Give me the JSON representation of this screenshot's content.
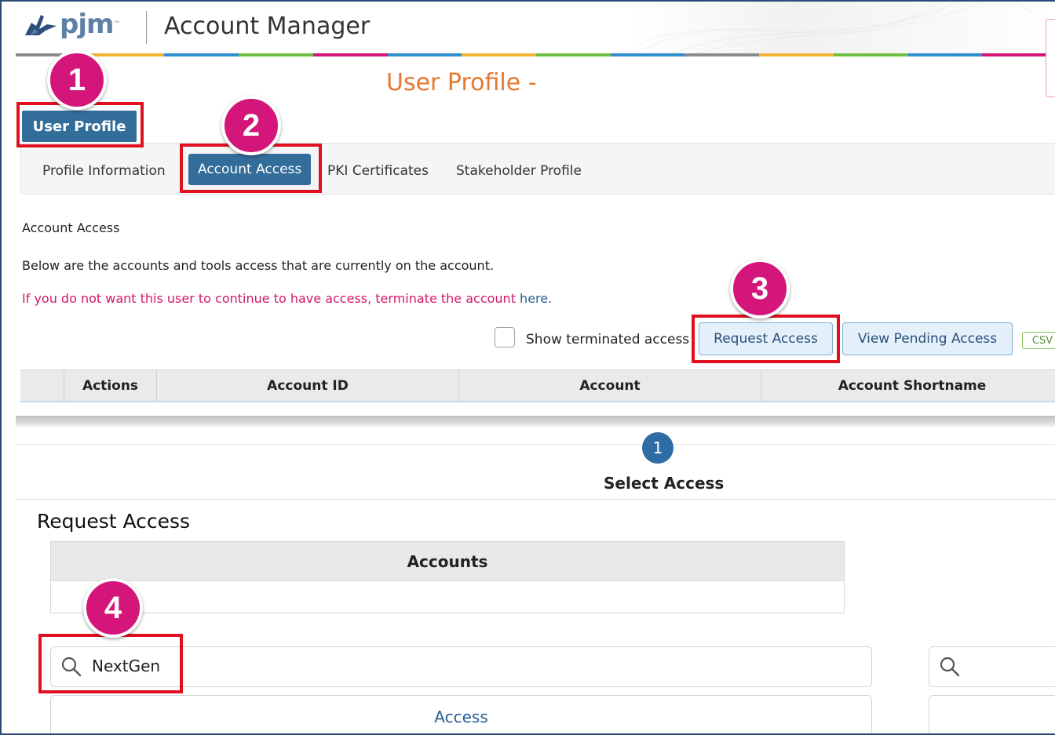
{
  "header": {
    "logo_text": "pjm",
    "logo_tm": "™",
    "app_title": "Account Manager",
    "stripe_colors": [
      "#8a8d8f",
      "#f5b335",
      "#2f8fcf",
      "#6fbf44",
      "#d4157a",
      "#2f8fcf",
      "#f5b335",
      "#6fbf44",
      "#2f8fcf",
      "#8a8d8f",
      "#f5b335",
      "#6fbf44",
      "#2f8fcf",
      "#d4157a"
    ]
  },
  "page": {
    "title": "User Profile -",
    "user_profile_button": "User Profile"
  },
  "tabs": [
    {
      "label": "Profile Information",
      "active": false
    },
    {
      "label": "Account Access",
      "active": true
    },
    {
      "label": "PKI Certificates",
      "active": false
    },
    {
      "label": "Stakeholder Profile",
      "active": false
    }
  ],
  "account_access": {
    "section_label": "Account Access",
    "description": "Below are the accounts and tools access that are currently on the account.",
    "warning_text": "If you do not want this user to continue to have access, terminate the account ",
    "warning_link": "here.",
    "show_terminated_label": "Show terminated access",
    "request_access_button": "Request Access",
    "view_pending_button": "View Pending Access",
    "csv_button": "CSV",
    "columns": [
      "Actions",
      "Account ID",
      "Account",
      "Account Shortname"
    ]
  },
  "wizard": {
    "step_number": "1",
    "step_label": "Select Access"
  },
  "request_access": {
    "title": "Request Access",
    "accounts_header": "Accounts",
    "search_value": "NextGen",
    "right_search_value": "",
    "access_header": "Access"
  },
  "annotations": {
    "markers": [
      "1",
      "2",
      "3",
      "4"
    ],
    "marker_color": "#d4157a",
    "highlight_color": "#e0101f"
  },
  "colors": {
    "primary": "#336d9a",
    "title_orange": "#e6782e",
    "warning_pink": "#d3176c",
    "link_blue": "#2b5d94"
  }
}
